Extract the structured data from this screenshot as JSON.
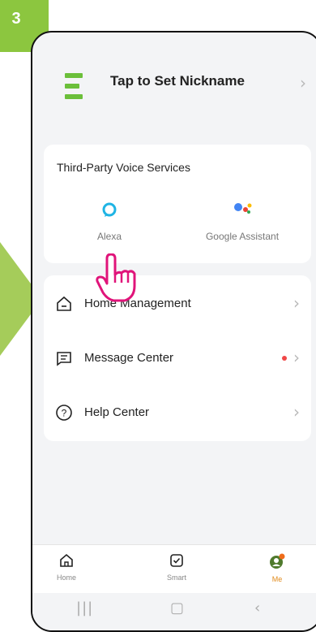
{
  "step": {
    "number": "3",
    "color": "#8cc63f"
  },
  "profile": {
    "nickname": "Tap to Set Nickname"
  },
  "voice_services": {
    "title": "Third-Party Voice Services",
    "items": [
      {
        "label": "Alexa",
        "icon": "alexa-icon"
      },
      {
        "label": "Google Assistant",
        "icon": "google-assistant-icon"
      }
    ]
  },
  "menu": [
    {
      "label": "Home Management",
      "icon": "house-icon"
    },
    {
      "label": "Message Center",
      "icon": "message-icon",
      "unread_dot": true
    },
    {
      "label": "Help Center",
      "icon": "help-icon"
    }
  ],
  "tabs": [
    {
      "label": "Home",
      "icon": "home-tab-icon"
    },
    {
      "label": "Smart",
      "icon": "smart-tab-icon"
    },
    {
      "label": "Me",
      "icon": "me-tab-icon",
      "active": true
    }
  ],
  "colors": {
    "accent": "#e08a1b",
    "brand_green": "#6bbf3a",
    "alert_dot": "#f04747",
    "annotation": "#e0147a"
  }
}
